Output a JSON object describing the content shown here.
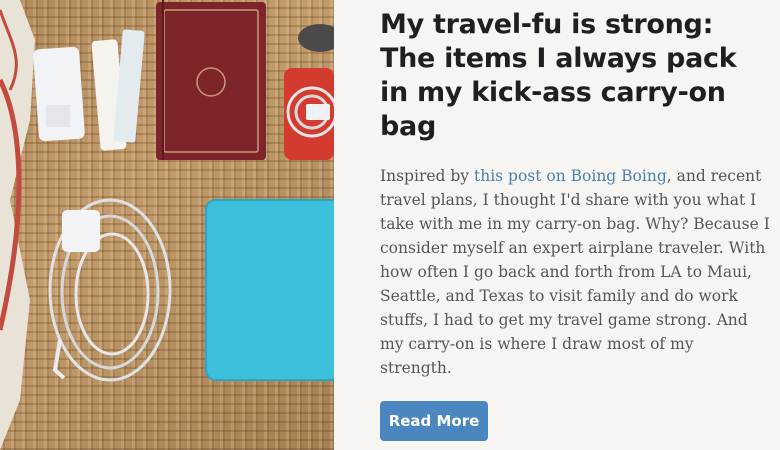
{
  "post": {
    "title": "My travel-fu is strong: The items I always pack in my kick-ass carry-on bag",
    "excerpt": {
      "before": "Inspired by ",
      "link_text": "this post on Boing Boing",
      "after": ", and recent travel plans, I thought I'd share with you what I take with me in my carry-on bag. Why? Because I consider myself an expert airplane traveler. With how often I go back and forth from LA to Maui, Seattle, and Texas to visit family and do work stuffs, I had to get my travel game strong. And my carry-on is where I draw most of my strength."
    },
    "read_more_label": "Read More"
  },
  "colors": {
    "link": "#4a7fb0",
    "button": "#4a86bf",
    "laptop": "#3cc0dc",
    "book": "#8a2a30"
  }
}
